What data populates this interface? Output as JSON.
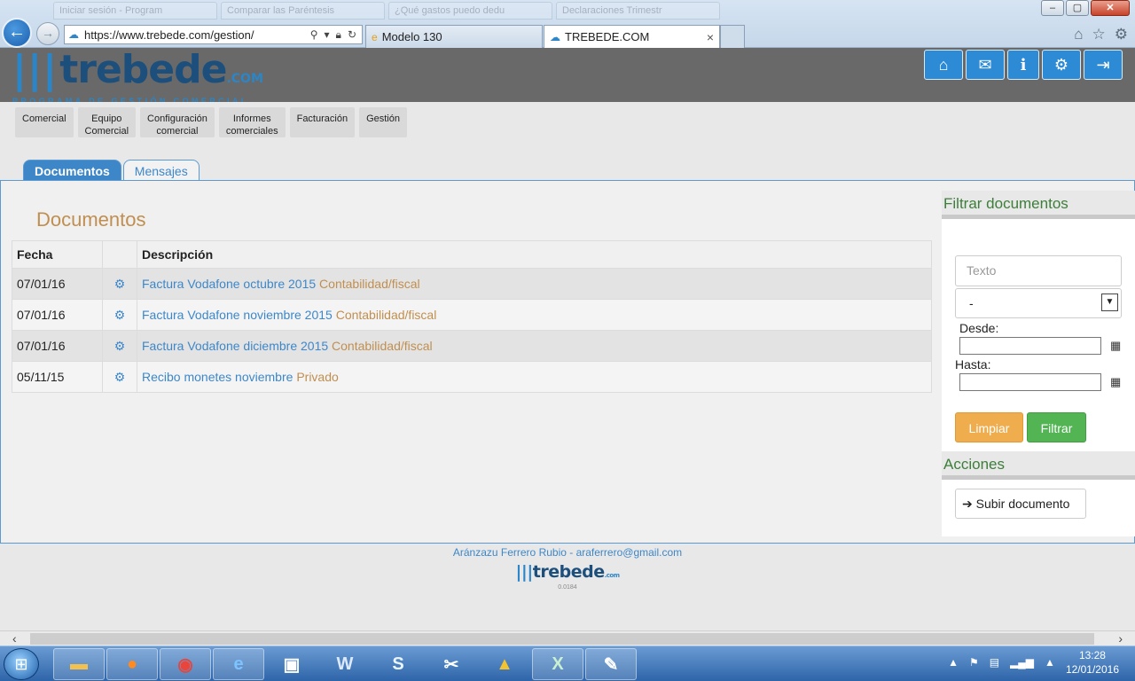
{
  "browser": {
    "ghost_tabs": [
      "Iniciar sesión - Program",
      "Comparar las Paréntesis",
      "¿Qué gastos puedo dedu",
      "Declaraciones Trimestr"
    ],
    "url": "https://www.trebede.com/gestion/",
    "tabs": [
      {
        "label": "Modelo 130",
        "icon": "ie-icon"
      },
      {
        "label": "TREBEDE.COM",
        "icon": "cloud-icon",
        "close": "×"
      }
    ],
    "window_buttons": {
      "minimize": "–",
      "maximize": "▢",
      "close": "✕"
    },
    "back_glyph": "←",
    "forward_glyph": "→"
  },
  "site": {
    "logo_bars": "|||",
    "logo_name": "trebede",
    "logo_com": ".COM",
    "logo_tagline": "PROGRAMA DE GESTIÓN COMERCIAL",
    "header_buttons": [
      "home-icon",
      "envelope-icon",
      "info-icon",
      "gear-icon",
      "logout-icon"
    ],
    "menu": [
      "Comercial",
      "Equipo\nComercial",
      "Configuración\ncomercial",
      "Informes\ncomerciales",
      "Facturación",
      "Gestión"
    ],
    "tabs": [
      {
        "label": "Documentos",
        "active": true
      },
      {
        "label": "Mensajes",
        "active": false
      }
    ]
  },
  "documents": {
    "title": "Documentos",
    "headers": [
      "Fecha",
      "",
      "Descripción"
    ],
    "rows": [
      {
        "date": "07/01/16",
        "name": "Factura Vodafone octubre 2015",
        "category": "Contabilidad/fiscal"
      },
      {
        "date": "07/01/16",
        "name": "Factura Vodafone noviembre 2015",
        "category": "Contabilidad/fiscal"
      },
      {
        "date": "07/01/16",
        "name": "Factura Vodafone diciembre 2015",
        "category": "Contabilidad/fiscal"
      },
      {
        "date": "05/11/15",
        "name": "Recibo monetes noviembre",
        "category": "Privado"
      }
    ]
  },
  "filter": {
    "title": "Filtrar documentos",
    "text_placeholder": "Texto",
    "select_value": "-",
    "from_label": "Desde:",
    "to_label": "Hasta:",
    "clear_label": "Limpiar",
    "filter_label": "Filtrar"
  },
  "actions": {
    "title": "Acciones",
    "upload_label": "Subir documento"
  },
  "footer": {
    "user": "Aránzazu Ferrero Rubio - araferrero@gmail.com",
    "logo_bars": "|||",
    "logo_name": "trebede",
    "logo_com": ".com",
    "version": "0.0184"
  },
  "taskbar": {
    "apps": [
      "explorer-icon",
      "firefox-icon",
      "chrome-icon",
      "ie-icon",
      "network-icon",
      "word-icon",
      "skype-icon",
      "media-icon",
      "drive-icon",
      "excel-icon",
      "paint-icon"
    ],
    "time": "13:28",
    "date": "12/01/2016"
  },
  "colors": {
    "accent_blue": "#3d87c9",
    "category_gold": "#c08f50",
    "filter_green": "#53b454",
    "clear_orange": "#efad4e"
  }
}
